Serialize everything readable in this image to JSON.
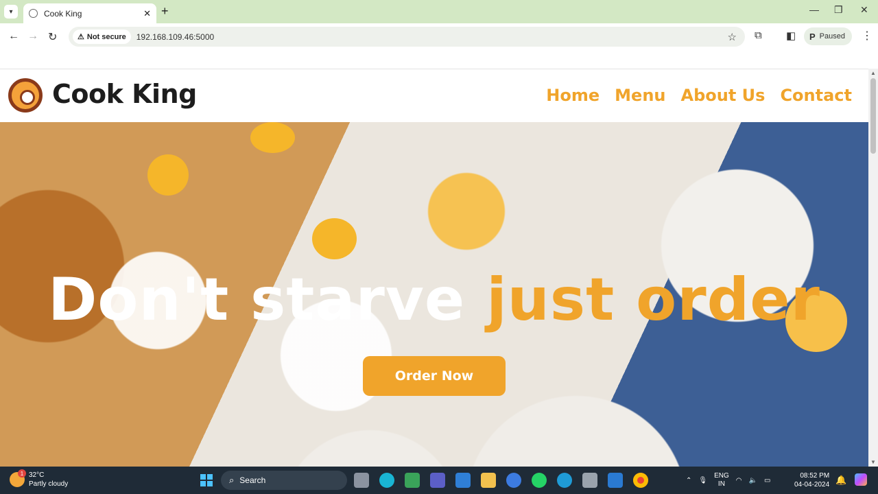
{
  "browser": {
    "tab_title": "Cook King",
    "url": "192.168.109.46:5000",
    "security_label": "Not secure",
    "profile_status": "Paused"
  },
  "site": {
    "brand": "Cook King",
    "nav": [
      {
        "label": "Home"
      },
      {
        "label": "Menu"
      },
      {
        "label": "About Us"
      },
      {
        "label": "Contact"
      }
    ],
    "headline_white": "Don't starve ",
    "headline_orange": "just order",
    "cta_label": "Order Now",
    "accent_color": "#f0a42b"
  },
  "taskbar": {
    "temperature": "32°C",
    "weather": "Partly cloudy",
    "weather_badge": "1",
    "search_placeholder": "Search",
    "lang_line1": "ENG",
    "lang_line2": "IN",
    "time": "08:52 PM",
    "date": "04-04-2024"
  }
}
